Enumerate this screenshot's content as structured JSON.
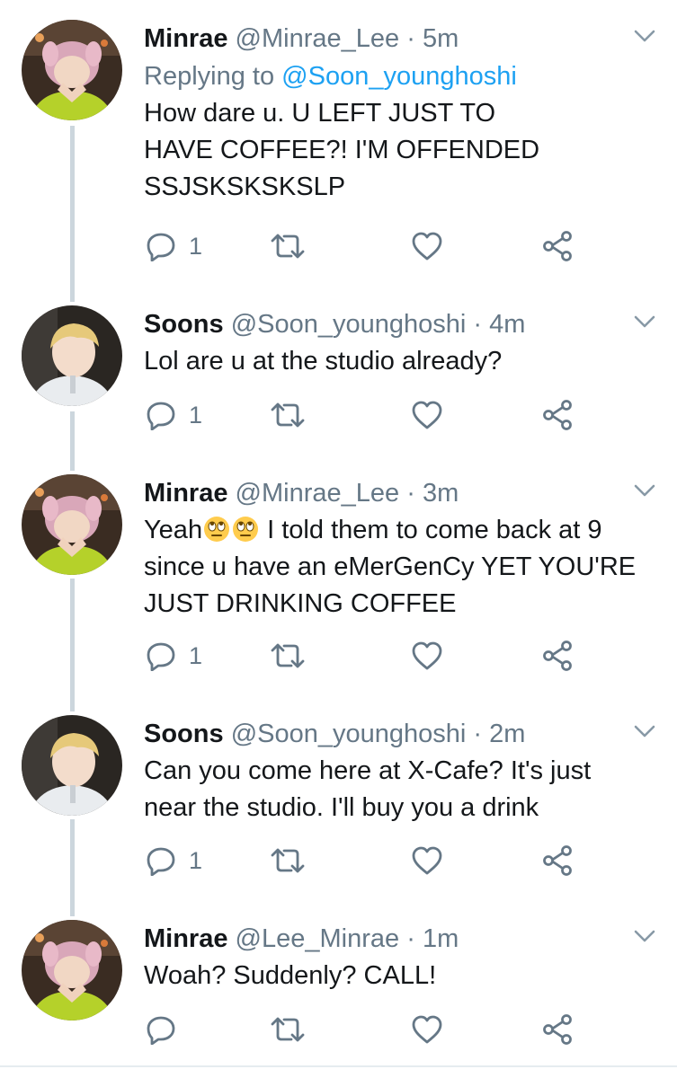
{
  "tweets": [
    {
      "name": "Minrae",
      "handle": "@Minrae_Lee",
      "dot": "·",
      "time": "5m",
      "replying_prefix": "Replying to ",
      "replying_handle": "@Soon_younghoshi",
      "text": "How dare u. U LEFT JUST TO\nHAVE COFFEE?! I'M OFFENDED\nSSJSKSKSKSLP",
      "reply_count": "1"
    },
    {
      "name": "Soons",
      "handle": "@Soon_younghoshi",
      "dot": "·",
      "time": "4m",
      "text": "Lol are u at the studio already?",
      "reply_count": "1"
    },
    {
      "name": "Minrae",
      "handle": "@Minrae_Lee",
      "dot": "·",
      "time": "3m",
      "text_start": "Yeah",
      "text_end": " I told them to come back at 9\nsince u have an eMerGenCy YET YOU'RE\nJUST DRINKING COFFEE",
      "emojis": [
        "eye-roll-emoji",
        "eye-roll-emoji"
      ],
      "reply_count": "1"
    },
    {
      "name": "Soons",
      "handle": "@Soon_younghoshi",
      "dot": "·",
      "time": "2m",
      "text": "Can you come here at X-Cafe? It's just\nnear the studio. I'll buy you a drink",
      "reply_count": "1"
    },
    {
      "name": "Minrae",
      "handle": "@Lee_Minrae",
      "dot": "·",
      "time": "1m",
      "text": "Woah? Suddenly? CALL!",
      "reply_count": ""
    }
  ],
  "icons": {
    "reply": "reply-icon",
    "retweet": "retweet-icon",
    "like": "heart-icon",
    "share": "share-icon",
    "menu": "chevron-down-icon"
  },
  "colors": {
    "text": "#14171a",
    "muted": "#657786",
    "link": "#1da1f2",
    "thread_line": "#ccd6dd"
  }
}
